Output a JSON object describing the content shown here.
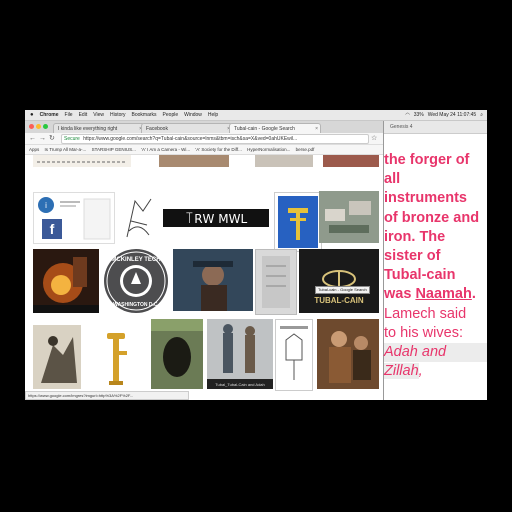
{
  "menubar": {
    "apple": "",
    "app": "Chrome",
    "items": [
      "File",
      "Edit",
      "View",
      "History",
      "Bookmarks",
      "People",
      "Window",
      "Help"
    ],
    "clock": "Wed May 24  11:07:45",
    "battery": "33%"
  },
  "browser": {
    "tabs": [
      {
        "label": "I kinda like everything right"
      },
      {
        "label": "Facebook"
      },
      {
        "label": "Tubal-cain - Google Search"
      }
    ],
    "url_secure": "Secure",
    "url": "https://www.google.com/search?q=Tubal-cain&source=lnms&tbm=isch&sa=X&ved=0ahUKEwil...",
    "bookmarks": [
      "Apps",
      "Is Trump All Mar-a-...",
      "STARSHIP GENIUS...",
      "'A' I Am a Camera - Wi...",
      "'A' Society for the Diff...",
      "HyperNormalisation...",
      "berse.pdf"
    ],
    "status_url": "https://www.google.com/imgres?imgurl=http%3A%2F%2F...",
    "tooltip": "Tubal-cain - Google Search",
    "image_texts": {
      "mckinley": "MCKINLEY TECH · WASHINGTON D.C.",
      "tubal_cain_logo": "TUBAL-CAIN",
      "symbols": "꓄ꓣꓪ ꓟꓪꓡ",
      "caption": "Tubal_Tubal-Cain and Adah"
    }
  },
  "document": {
    "toolbar_label": "Genesis 4",
    "lines_bold": [
      "the forger of",
      "all",
      "instruments",
      "of bronze and",
      "iron. The",
      "sister of",
      "Tubal-cain"
    ],
    "was": "was ",
    "naamah": "Naamah",
    "period": ".",
    "lamech1": "Lamech said",
    "lamech2": "to his wives:",
    "adah": "Adah and",
    "zillah": "Zillah",
    "comma": ","
  }
}
